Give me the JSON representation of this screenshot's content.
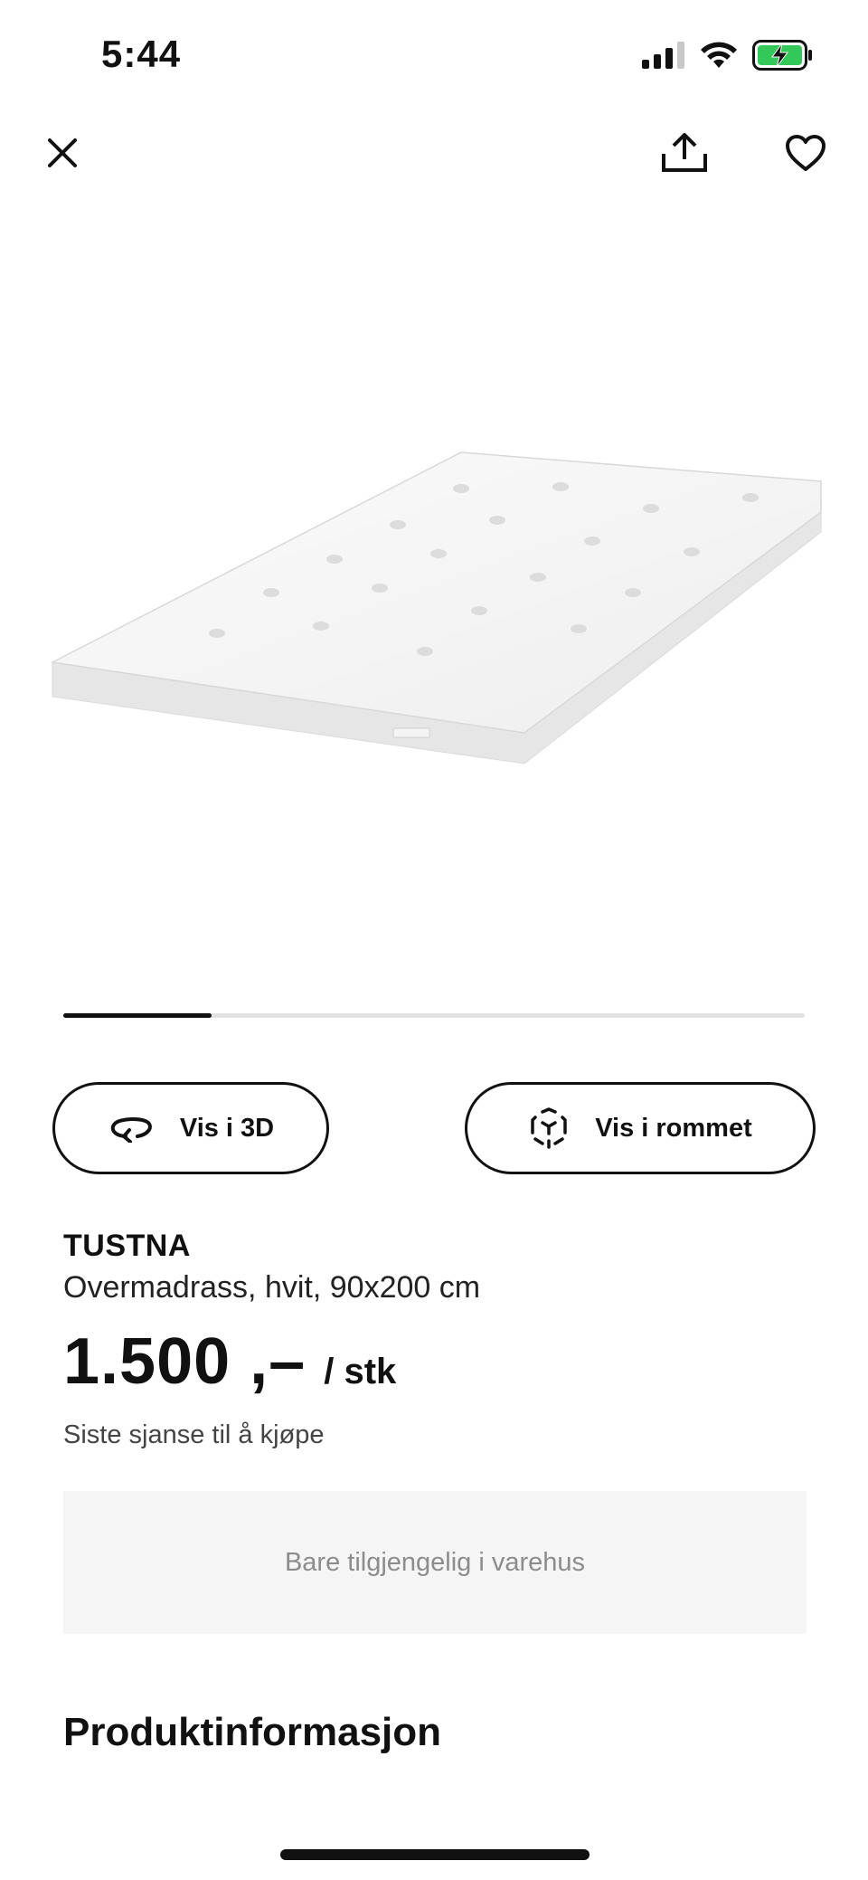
{
  "status_bar": {
    "time": "5:44",
    "battery_charging": true
  },
  "top_bar": {
    "close_icon": "close-icon",
    "share_icon": "share-icon",
    "favorite_icon": "heart-icon"
  },
  "carousel": {
    "position": 0.2
  },
  "actions": {
    "view_3d_label": "Vis i 3D",
    "view_in_room_label": "Vis i rommet"
  },
  "product": {
    "name": "TUSTNA",
    "description": "Overmadrass, hvit, 90x200 cm",
    "price": "1.500 ,–",
    "price_unit": "/ stk",
    "notice": "Siste sjanse til å kjøpe",
    "availability": "Bare tilgjengelig i varehus"
  },
  "section": {
    "title": "Produktinformasjon"
  },
  "colors": {
    "battery": "#34c759",
    "text": "#111111",
    "muted": "#8c8c8c",
    "panel": "#f5f5f5"
  }
}
